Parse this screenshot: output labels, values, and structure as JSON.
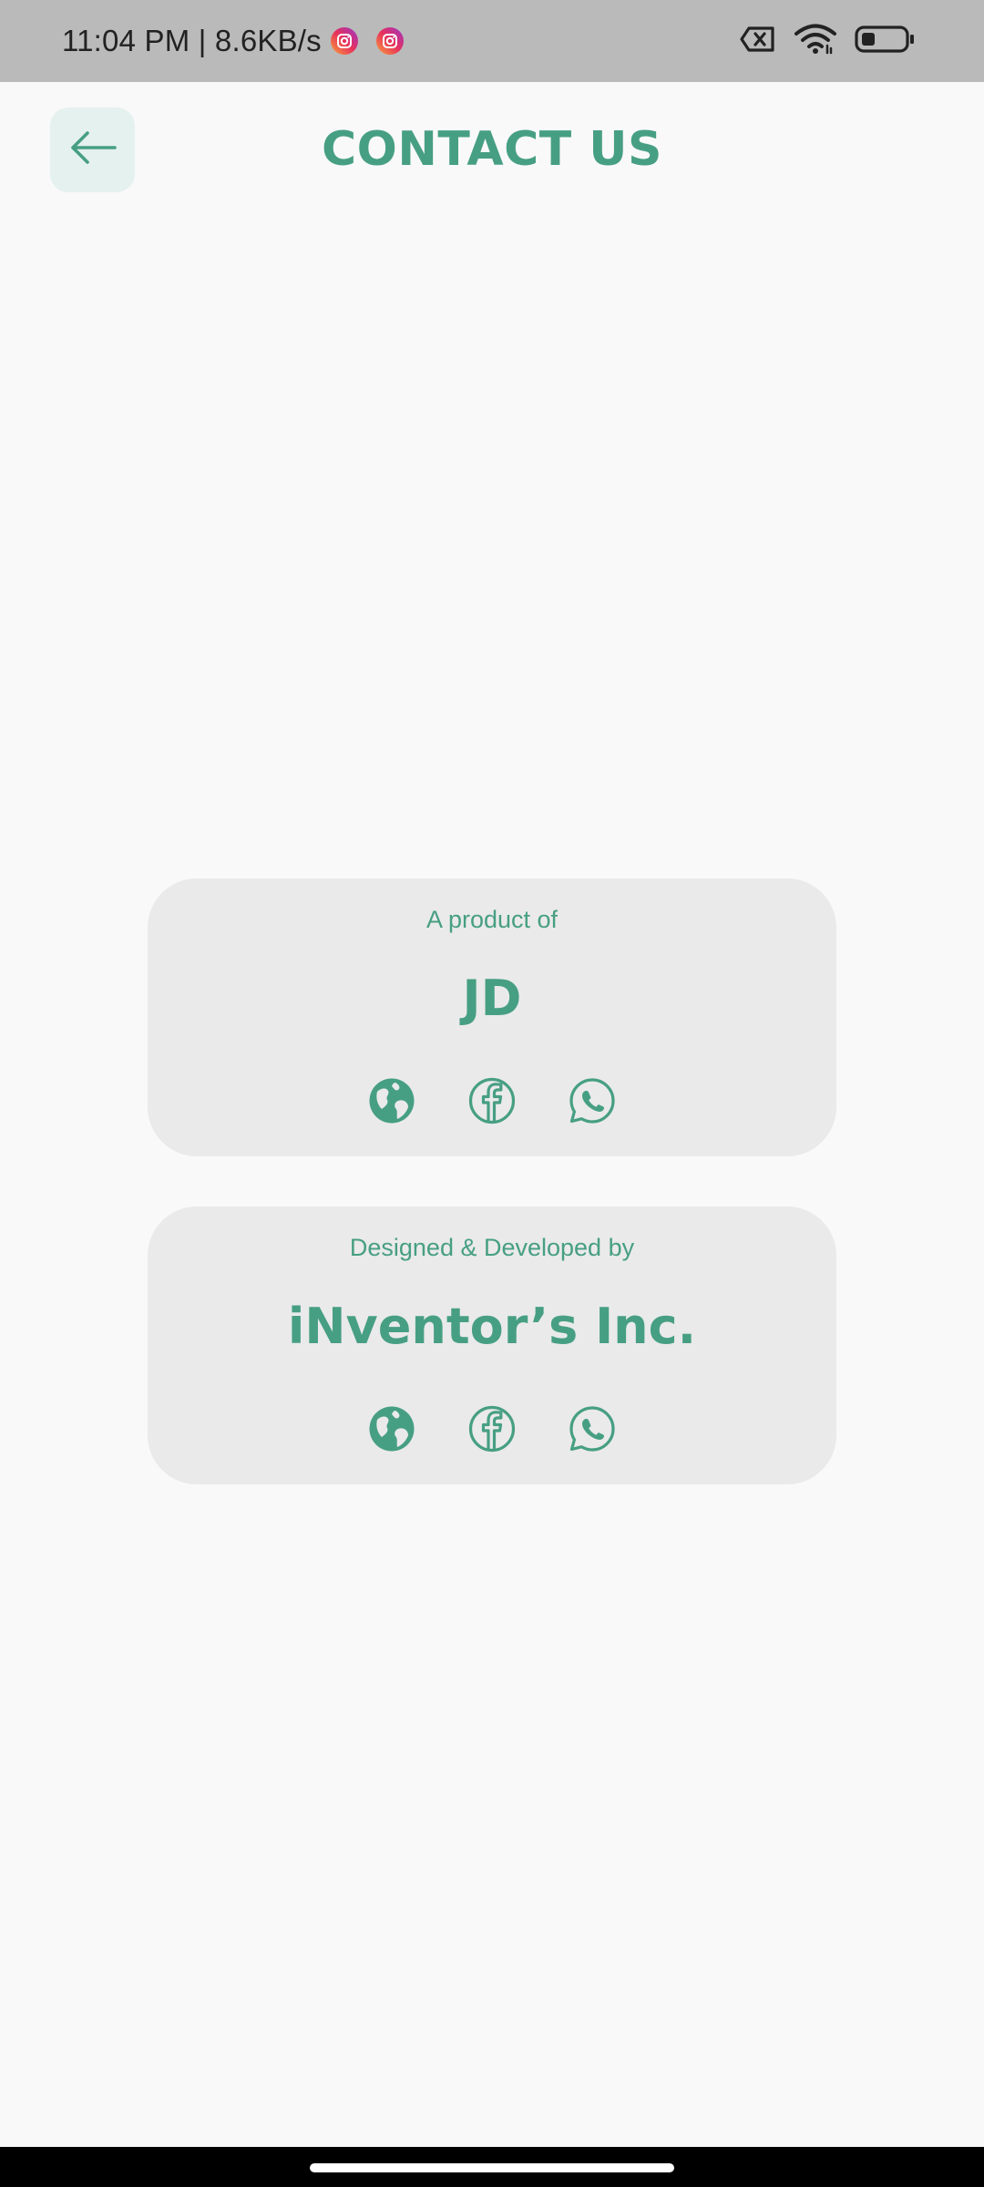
{
  "status_bar": {
    "text": "11:04 PM | 8.6KB/s",
    "notification_icons": [
      "instagram-icon",
      "instagram-icon"
    ],
    "system_icons": [
      "no-sim-icon",
      "wifi-icon",
      "battery-low-icon"
    ]
  },
  "header": {
    "title": "CONTACT US",
    "back_icon": "arrow-left-icon"
  },
  "cards": [
    {
      "caption": "A product of",
      "name": "JD",
      "icons": [
        "globe-icon",
        "facebook-icon",
        "whatsapp-icon"
      ]
    },
    {
      "caption": "Designed & Developed by",
      "name": "iNventor’s Inc.",
      "icons": [
        "globe-icon",
        "facebook-icon",
        "whatsapp-icon"
      ]
    }
  ],
  "colors": {
    "accent": "#479F83",
    "background": "#F9F9F9",
    "card": "#EAEAEA",
    "status_bar": "#BABABA",
    "back_button_bg": "#E5F1EE"
  }
}
